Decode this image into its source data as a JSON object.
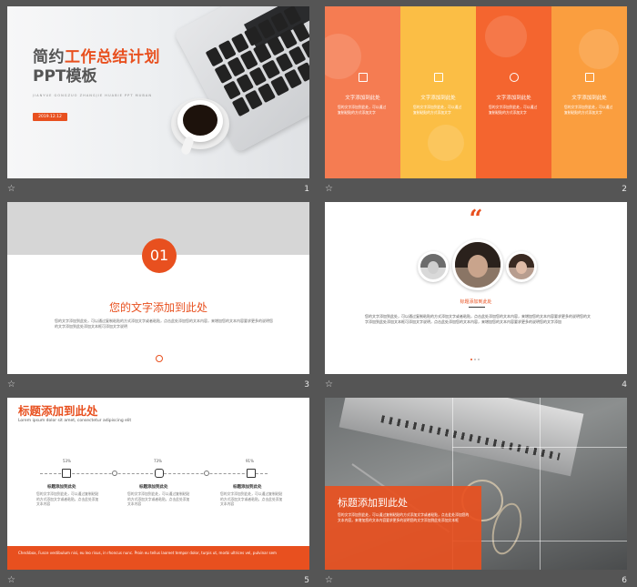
{
  "slides": [
    {
      "number": "1",
      "title_part1": "简约",
      "title_highlight": "工作总结计划",
      "title_line2": "PPT模板",
      "subtitle": "JIANYUE GONGZUO ZHANGJIE HUABIE PPT MUBAN",
      "date": "2019.12.12"
    },
    {
      "number": "2",
      "columns": [
        {
          "title": "文字添加到此处",
          "text": "您的文字添加到此处，可以通过复制粘贴的方式添加文字",
          "color": "#f57c52",
          "icon": "image-icon"
        },
        {
          "title": "文字添加到此处",
          "text": "您的文字添加到此处，可以通过复制粘贴的方式添加文字",
          "color": "#fbbe45",
          "icon": "document-icon"
        },
        {
          "title": "文字添加到此处",
          "text": "您的文字添加到此处，可以通过复制粘贴的方式添加文字",
          "color": "#f4652f",
          "icon": "layers-icon"
        },
        {
          "title": "文字添加到此处",
          "text": "您的文字添加到此处，可以通过复制粘贴的方式添加文字",
          "color": "#fa9e3f",
          "icon": "calendar-icon"
        }
      ]
    },
    {
      "number": "3",
      "section": "01",
      "heading": "您的文字添加到此处",
      "body": "您的文字添加到此处，可以通过复制粘贴的方式添加文字或者粘贴，点击此处添加您的文本内容，来增加您的文本内容要求更多的说明您的文字添加到此处添加文本框可添加文字说明"
    },
    {
      "number": "4",
      "quote_mark": "“",
      "name": "标题添加到此处",
      "body": "您的文字添加到此处，可以通过复制粘贴的方式添加文字或者粘贴，点击此处添加您的文本内容，来增加您的文本内容要求更多的说明您的文字添加到此处添加文本框可添加文字说明，点击此处添加您的文本内容，来增加您的文本内容要求更多的说明您的文字添加"
    },
    {
      "number": "5",
      "heading": "标题添加到此处",
      "subheading": "Lorem ipsum dolor sit amet, consectetur adipiscing elit",
      "steps": [
        {
          "pct": "53%",
          "title": "标题添加到此处",
          "text": "您的文字添加到此处，可以通过复制粘贴的方式添加文字或者粘贴，点击此处添加文本内容"
        },
        {
          "pct": "73%",
          "title": "标题添加到此处",
          "text": "您的文字添加到此处，可以通过复制粘贴的方式添加文字或者粘贴，点击此处添加文本内容"
        },
        {
          "pct": "91%",
          "title": "标题添加到此处",
          "text": "您的文字添加到此处，可以通过复制粘贴的方式添加文字或者粘贴，点击此处添加文本内容"
        }
      ],
      "footer_text": "Checkbox, Fusce vestibulum nisi, eu leo risus, in rhoncus nunc. Proin eu tellus laoreet tempor dolor, turpis ut, morbi ultrices vel, pulvinar sem"
    },
    {
      "number": "6",
      "heading": "标题添加到此处",
      "body": "您的文字添加到此处，可以通过复制粘贴的方式添加文字或者粘贴，点击此处添加您的文本内容，来增加您的文本内容要求更多的说明您的文字添加到此处添加文本框"
    }
  ]
}
